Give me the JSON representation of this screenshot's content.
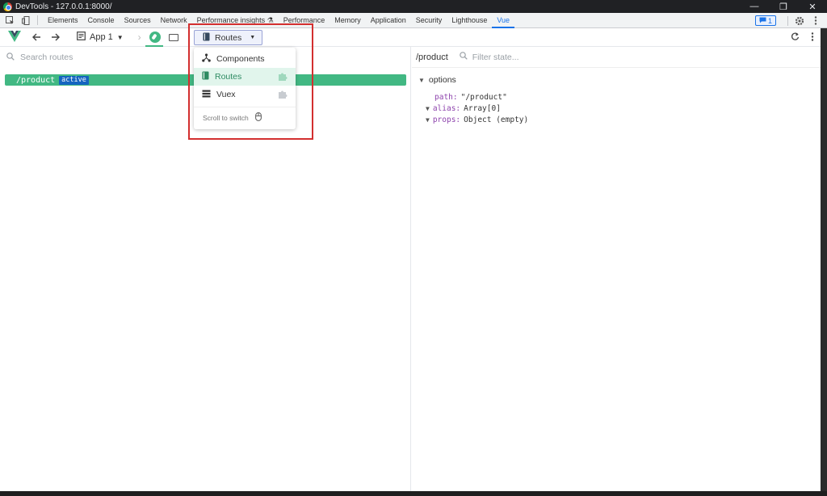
{
  "window": {
    "title": "DevTools - 127.0.0.1:8000/",
    "minimize": "—",
    "restore": "❐",
    "close": "✕"
  },
  "devtools_tabs": [
    {
      "label": "Elements"
    },
    {
      "label": "Console"
    },
    {
      "label": "Sources"
    },
    {
      "label": "Network"
    },
    {
      "label": "Performance insights ⚗"
    },
    {
      "label": "Performance"
    },
    {
      "label": "Memory"
    },
    {
      "label": "Application"
    },
    {
      "label": "Security"
    },
    {
      "label": "Lighthouse"
    },
    {
      "label": "Vue"
    }
  ],
  "issues_count": "1",
  "vue_toolbar": {
    "app_label": "App 1",
    "routes_button": "Routes"
  },
  "dropdown": {
    "items": [
      {
        "label": "Components"
      },
      {
        "label": "Routes"
      },
      {
        "label": "Vuex"
      }
    ],
    "hint": "Scroll to switch"
  },
  "left": {
    "search_placeholder": "Search routes",
    "route_path": "/product",
    "route_badge": "active"
  },
  "right": {
    "title": "/product",
    "filter_placeholder": "Filter state...",
    "section": "options",
    "state": {
      "path_key": "path:",
      "path_val": "\"/product\"",
      "alias_key": "alias:",
      "alias_val": "Array[0]",
      "props_key": "props:",
      "props_val": "Object (empty)"
    }
  },
  "colors": {
    "vue_green": "#42b883",
    "highlight_red": "#d32f2f",
    "badge_blue": "#1565c0"
  }
}
